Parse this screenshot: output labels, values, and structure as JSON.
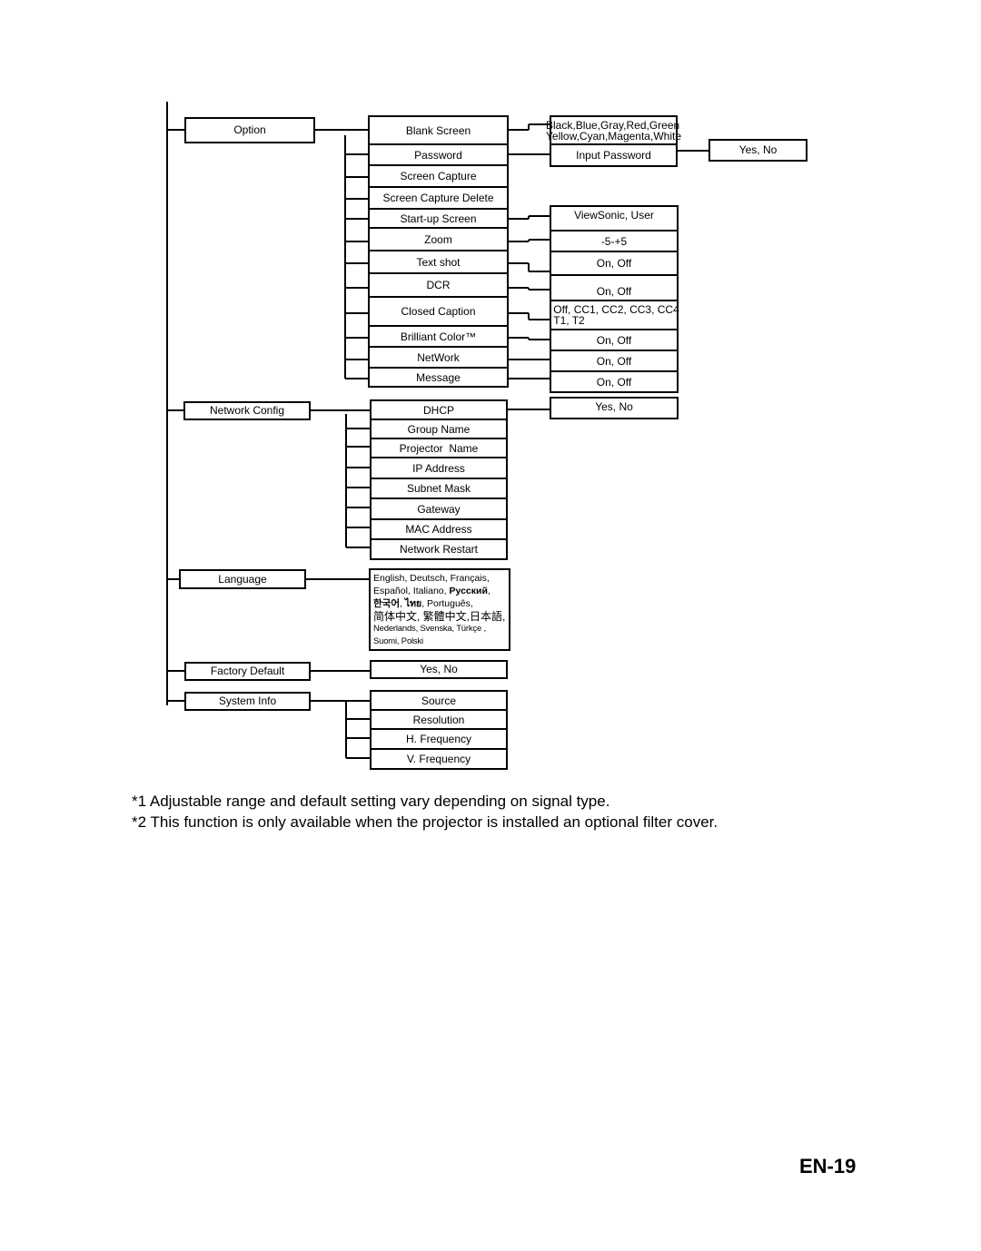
{
  "menu": {
    "option": {
      "label": "Option",
      "items": [
        {
          "label": "Blank Screen",
          "value": "Black,Blue,Gray,Red,Green\nYellow,Cyan,Magenta,White"
        },
        {
          "label": "Password",
          "value": "Input Password",
          "sub_value": "Yes, No"
        },
        {
          "label": "Screen Capture"
        },
        {
          "label": "Screen Capture Delete"
        },
        {
          "label": "Start-up Screen",
          "value": "ViewSonic, User"
        },
        {
          "label": "Zoom",
          "value": "-5-+5"
        },
        {
          "label": "Text shot",
          "value": "On, Off"
        },
        {
          "label": "DCR",
          "value": "On, Off"
        },
        {
          "label": "Closed Caption",
          "value": "Off, CC1, CC2, CC3, CC4\nT1, T2"
        },
        {
          "label": "Brilliant Color™",
          "value": "On, Off"
        },
        {
          "label": "NetWork",
          "value": "On, Off"
        },
        {
          "label": "Message",
          "value": "On, Off"
        }
      ]
    },
    "network_config": {
      "label": "Network Config",
      "items": [
        {
          "label": "DHCP",
          "value": "Yes, No"
        },
        {
          "label": "Group Name"
        },
        {
          "label": "Projector  Name"
        },
        {
          "label": "IP Address"
        },
        {
          "label": "Subnet Mask"
        },
        {
          "label": "Gateway"
        },
        {
          "label": "MAC Address"
        },
        {
          "label": "Network Restart"
        }
      ]
    },
    "language": {
      "label": "Language",
      "options_lines": [
        "English, Deutsch, Français,",
        "Español, Italiano, ",
        "Русский",
        "한국어",
        "ไทย",
        ", Português,",
        "简体中文, 繁體中文,日本語,",
        "Nederlands, Svenska, Türkçe ,",
        "Suomi, Polski"
      ]
    },
    "factory_default": {
      "label": "Factory Default",
      "value": "Yes, No"
    },
    "system_info": {
      "label": "System Info",
      "items": [
        {
          "label": "Source"
        },
        {
          "label": "Resolution"
        },
        {
          "label": "H. Frequency"
        },
        {
          "label": "V. Frequency"
        }
      ]
    }
  },
  "notes": [
    "*1 Adjustable range and default setting vary depending on signal type.",
    "*2 This function is only available when the projector is installed an optional filter cover."
  ],
  "page_number": "EN-19"
}
